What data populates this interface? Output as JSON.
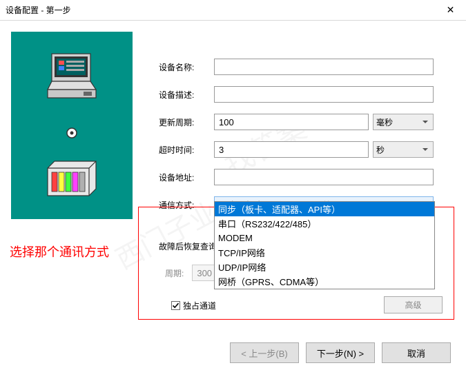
{
  "window": {
    "title": "设备配置 - 第一步"
  },
  "form": {
    "device_name_label": "设备名称:",
    "device_name_value": "",
    "device_desc_label": "设备描述:",
    "device_desc_value": "",
    "update_cycle_label": "更新周期:",
    "update_cycle_value": "100",
    "update_cycle_unit": "毫秒",
    "timeout_label": "超时时间:",
    "timeout_value": "3",
    "timeout_unit": "秒",
    "device_addr_label": "设备地址:",
    "device_addr_value": "",
    "comm_mode_label": "通信方式:",
    "comm_mode_selected": "同步（板卡、适配器、API等）",
    "comm_mode_options": [
      "同步（板卡、适配器、API等）",
      "串口（RS232/422/485）",
      "MODEM",
      "TCP/IP网络",
      "UDP/IP网络",
      "网桥（GPRS、CDMA等）"
    ],
    "fault_recover_label": "故障后恢复查询",
    "cycle_label": "周期:",
    "cycle_value": "300",
    "exclusive_channel_label": "独占通道",
    "exclusive_channel_checked": true,
    "advanced_label": "高级"
  },
  "annotation": "选择那个通讯方式",
  "footer": {
    "back_label": "< 上一步(B)",
    "next_label": "下一步(N) >",
    "cancel_label": "取消"
  },
  "watermark1": "找答案",
  "watermark2": "西门子业"
}
